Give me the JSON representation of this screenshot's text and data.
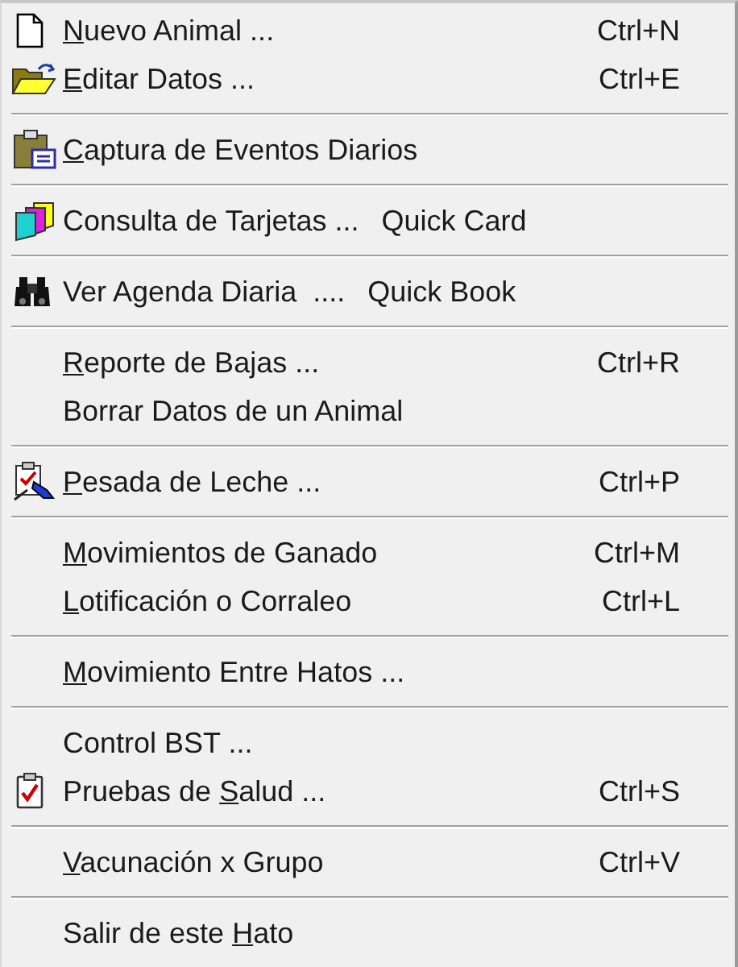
{
  "menu": {
    "groups": [
      {
        "items": [
          {
            "kind": "document",
            "label": [
              {
                "text": "N",
                "underlined": true
              },
              {
                "text": "uevo Animal ...",
                "underlined": false
              }
            ],
            "shortcut": "Ctrl+N"
          },
          {
            "kind": "folder",
            "label": [
              {
                "text": "E",
                "underlined": true
              },
              {
                "text": "ditar Datos ...",
                "underlined": false
              }
            ],
            "shortcut": "Ctrl+E"
          }
        ]
      },
      {
        "items": [
          {
            "kind": "clipboard",
            "label": [
              {
                "text": "C",
                "underlined": true
              },
              {
                "text": "aptura de Eventos Diarios",
                "underlined": false
              }
            ]
          }
        ]
      },
      {
        "items": [
          {
            "kind": "cards",
            "label": [
              {
                "text": "Consulta de Tarjetas ...",
                "underlined": false
              }
            ],
            "quick": "Quick Card"
          }
        ]
      },
      {
        "items": [
          {
            "kind": "binoculars",
            "label": [
              {
                "text": "Ver Agenda Diaria  ....",
                "underlined": false
              }
            ],
            "quick": "Quick Book"
          }
        ]
      },
      {
        "items": [
          {
            "kind": "plain",
            "label": [
              {
                "text": "R",
                "underlined": true
              },
              {
                "text": "eporte de Bajas ...",
                "underlined": false
              }
            ],
            "shortcut": "Ctrl+R"
          },
          {
            "kind": "plain",
            "label": [
              {
                "text": "Borrar Datos de un Animal",
                "underlined": false
              }
            ]
          }
        ]
      },
      {
        "items": [
          {
            "kind": "weighing",
            "label": [
              {
                "text": "P",
                "underlined": true
              },
              {
                "text": "esada de Leche ...",
                "underlined": false
              }
            ],
            "shortcut": "Ctrl+P"
          }
        ]
      },
      {
        "items": [
          {
            "kind": "plain",
            "label": [
              {
                "text": "M",
                "underlined": true
              },
              {
                "text": "ovimientos de Ganado",
                "underlined": false
              }
            ],
            "shortcut": "Ctrl+M"
          },
          {
            "kind": "plain",
            "label": [
              {
                "text": "L",
                "underlined": true
              },
              {
                "text": "otificación o Corraleo",
                "underlined": false
              }
            ],
            "shortcut": "Ctrl+L"
          }
        ]
      },
      {
        "items": [
          {
            "kind": "plain",
            "label": [
              {
                "text": "M",
                "underlined": true
              },
              {
                "text": "ovimiento Entre Hatos ...",
                "underlined": false
              }
            ]
          }
        ]
      },
      {
        "items": [
          {
            "kind": "plain",
            "label": [
              {
                "text": "Control BST ...",
                "underlined": false
              }
            ]
          },
          {
            "kind": "health",
            "label": [
              {
                "text": "Pruebas de ",
                "underlined": false
              },
              {
                "text": "S",
                "underlined": true
              },
              {
                "text": "alud ...",
                "underlined": false
              }
            ],
            "shortcut": "Ctrl+S"
          }
        ]
      },
      {
        "items": [
          {
            "kind": "plain",
            "label": [
              {
                "text": "V",
                "underlined": true
              },
              {
                "text": "acunación x Grupo",
                "underlined": false
              }
            ],
            "shortcut": "Ctrl+V"
          }
        ]
      },
      {
        "items": [
          {
            "kind": "plain",
            "label": [
              {
                "text": "Salir de este ",
                "underlined": false
              },
              {
                "text": "H",
                "underlined": true
              },
              {
                "text": "ato",
                "underlined": false
              }
            ]
          }
        ]
      }
    ]
  }
}
